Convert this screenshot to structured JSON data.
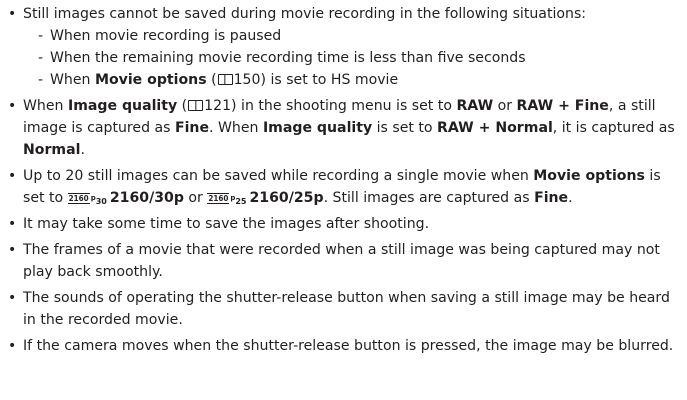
{
  "items": {
    "b1": {
      "text": "Still images cannot be saved during movie recording in the following situations:",
      "sub1": "When movie recording is paused",
      "sub2": "When the remaining movie recording time is less than five seconds",
      "sub3_pre": "When ",
      "sub3_bold": "Movie options",
      "sub3_open": " (",
      "sub3_ref": "150) is set to HS movie",
      "dash": "-"
    },
    "b2": {
      "pre": "When ",
      "bold1": "Image quality",
      "open": " (",
      "ref": "121) in the shooting menu is set to ",
      "bold2": "RAW",
      "or": " or ",
      "bold3": "RAW + Fine",
      "mid": ", a still image is captured as ",
      "bold4": "Fine",
      "mid2": ". When ",
      "bold5": "Image quality",
      "mid3": " is set to ",
      "bold6": "RAW + Normal",
      "mid4": ", it is captured as ",
      "bold7": "Normal",
      "end": "."
    },
    "b3": {
      "pre": "Up to 20 still images can be saved while recording a single movie when ",
      "bold1": "Movie options",
      "mid": " is set to ",
      "res_icon_1": "2160",
      "fps_icon_1_p": "p",
      "fps_icon_1": "30",
      "bold2": "2160/30p",
      "or": " or ",
      "res_icon_2": "2160",
      "fps_icon_2_p": "p",
      "fps_icon_2": "25",
      "bold3": "2160/25p",
      "mid2": ". Still images are captured as ",
      "bold4": "Fine",
      "end": "."
    },
    "b4": "It may take some time to save the images after shooting.",
    "b5": "The frames of a movie that were recorded when a still image was being captured may not play back smoothly.",
    "b6": "The sounds of operating the shutter-release button when saving a still image may be heard in the recorded movie.",
    "b7": "If the camera moves when the shutter-release button is pressed, the image may be blurred."
  }
}
